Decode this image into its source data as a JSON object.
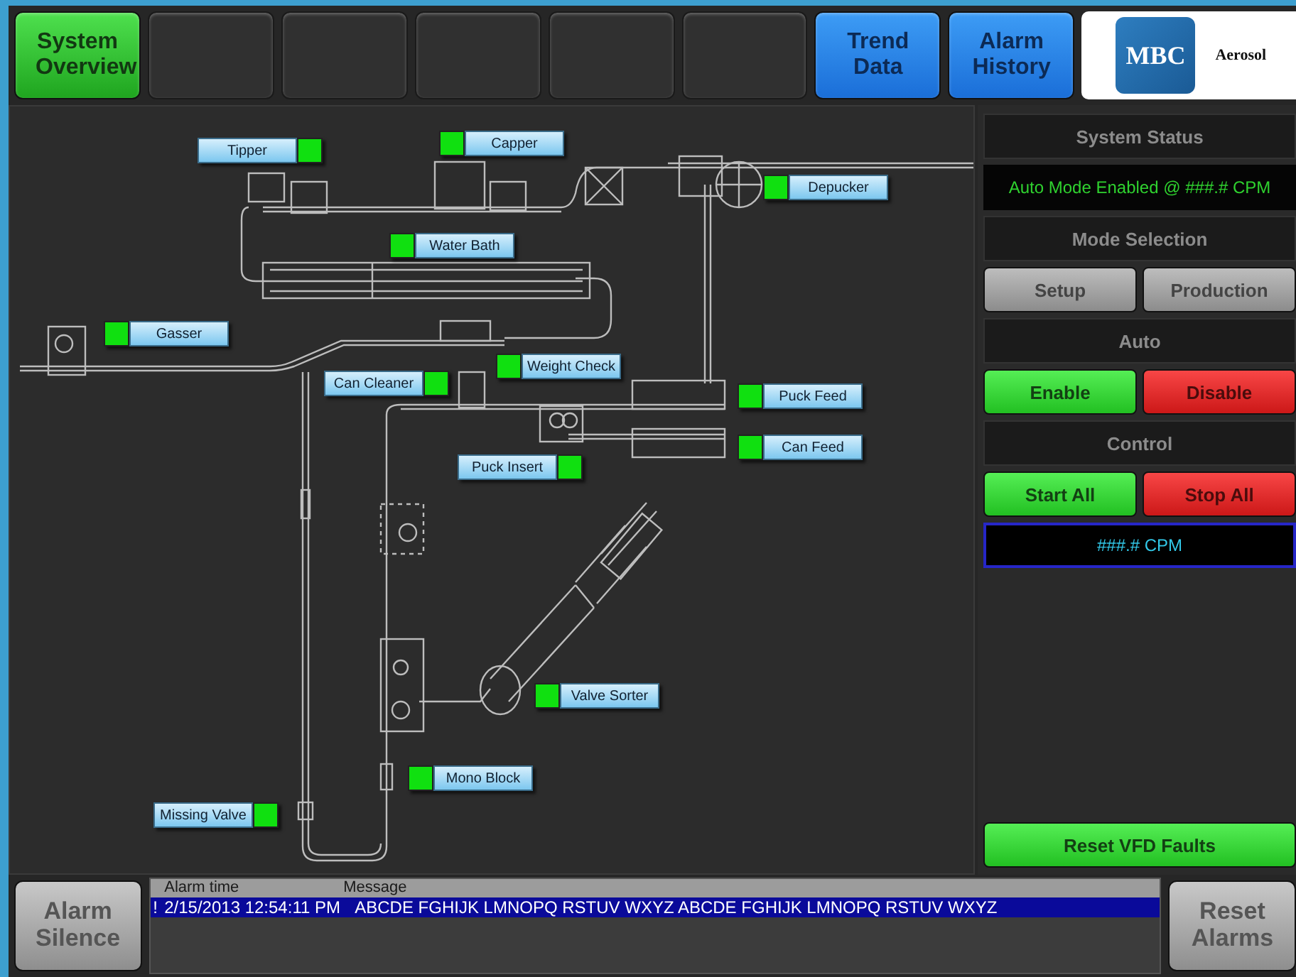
{
  "nav": [
    {
      "kind": "button",
      "label": "System Overview",
      "selected": true
    },
    {
      "kind": "blank"
    },
    {
      "kind": "blank"
    },
    {
      "kind": "blank"
    },
    {
      "kind": "blank"
    },
    {
      "kind": "blank"
    },
    {
      "kind": "button",
      "label": "Trend Data",
      "selected": false
    },
    {
      "kind": "button",
      "label": "Alarm History",
      "selected": false
    }
  ],
  "logo": {
    "mark": "MBC",
    "text": "Aerosol"
  },
  "stations": [
    {
      "label": "Tipper",
      "on": true
    },
    {
      "label": "Capper",
      "on": true
    },
    {
      "label": "Depucker",
      "on": true
    },
    {
      "label": "Water Bath",
      "on": true
    },
    {
      "label": "Gasser",
      "on": true
    },
    {
      "label": "Weight Check",
      "on": true
    },
    {
      "label": "Can Cleaner",
      "on": true
    },
    {
      "label": "Puck Feed",
      "on": true
    },
    {
      "label": "Can Feed",
      "on": true
    },
    {
      "label": "Puck Insert",
      "on": true
    },
    {
      "label": "Valve Sorter",
      "on": true
    },
    {
      "label": "Mono Block",
      "on": true
    },
    {
      "label": "Missing Valve",
      "on": true
    }
  ],
  "side_panel": [
    {
      "kind": "header",
      "text": "System Status"
    },
    {
      "kind": "status",
      "text": "Auto Mode Enabled @ ###.# CPM"
    },
    {
      "kind": "header",
      "text": "Mode Selection"
    },
    {
      "kind": "buttons",
      "buttons": [
        {
          "label": "Setup",
          "kind": "neutral"
        },
        {
          "label": "Production",
          "kind": "neutral"
        }
      ]
    },
    {
      "kind": "header",
      "text": "Auto"
    },
    {
      "kind": "buttons",
      "buttons": [
        {
          "label": "Enable",
          "kind": "go"
        },
        {
          "label": "Disable",
          "kind": "stop"
        }
      ]
    },
    {
      "kind": "header",
      "text": "Control"
    },
    {
      "kind": "buttons",
      "buttons": [
        {
          "label": "Start All",
          "kind": "go"
        },
        {
          "label": "Stop All",
          "kind": "stop"
        }
      ]
    },
    {
      "kind": "readout",
      "text": "###.# CPM"
    },
    {
      "kind": "spacer"
    },
    {
      "kind": "buttons",
      "buttons": [
        {
          "label": "Reset VFD Faults",
          "kind": "go"
        }
      ]
    }
  ],
  "alarm_silence": "Alarm Silence",
  "alarms": {
    "columns": [
      "Alarm time",
      "Message"
    ],
    "rows": [
      {
        "flag": "!",
        "time": "2/15/2013 12:54:11 PM",
        "message": "ABCDE FGHIJK LMNOPQ RSTUV WXYZ ABCDE FGHIJK LMNOPQ RSTUV WXYZ",
        "selected": true
      }
    ]
  },
  "reset_alarms": "Reset Alarms"
}
